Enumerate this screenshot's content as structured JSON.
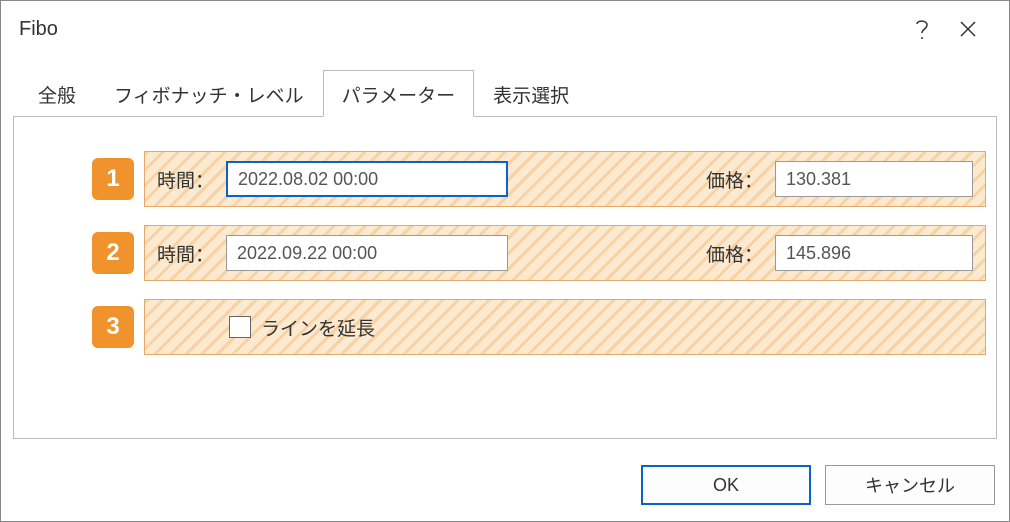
{
  "window": {
    "title": "Fibo"
  },
  "tabs": {
    "general": "全般",
    "levels": "フィボナッチ・レベル",
    "parameters": "パラメーター",
    "display": "表示選択"
  },
  "badges": {
    "one": "1",
    "two": "2",
    "three": "3"
  },
  "labels": {
    "time": "時間：",
    "price": "価格：",
    "extend_line": "ラインを延長"
  },
  "fields": {
    "row1": {
      "time": "2022.08.02 00:00",
      "price": "130.381"
    },
    "row2": {
      "time": "2022.09.22 00:00",
      "price": "145.896"
    }
  },
  "buttons": {
    "ok": "OK",
    "cancel": "キャンセル"
  }
}
